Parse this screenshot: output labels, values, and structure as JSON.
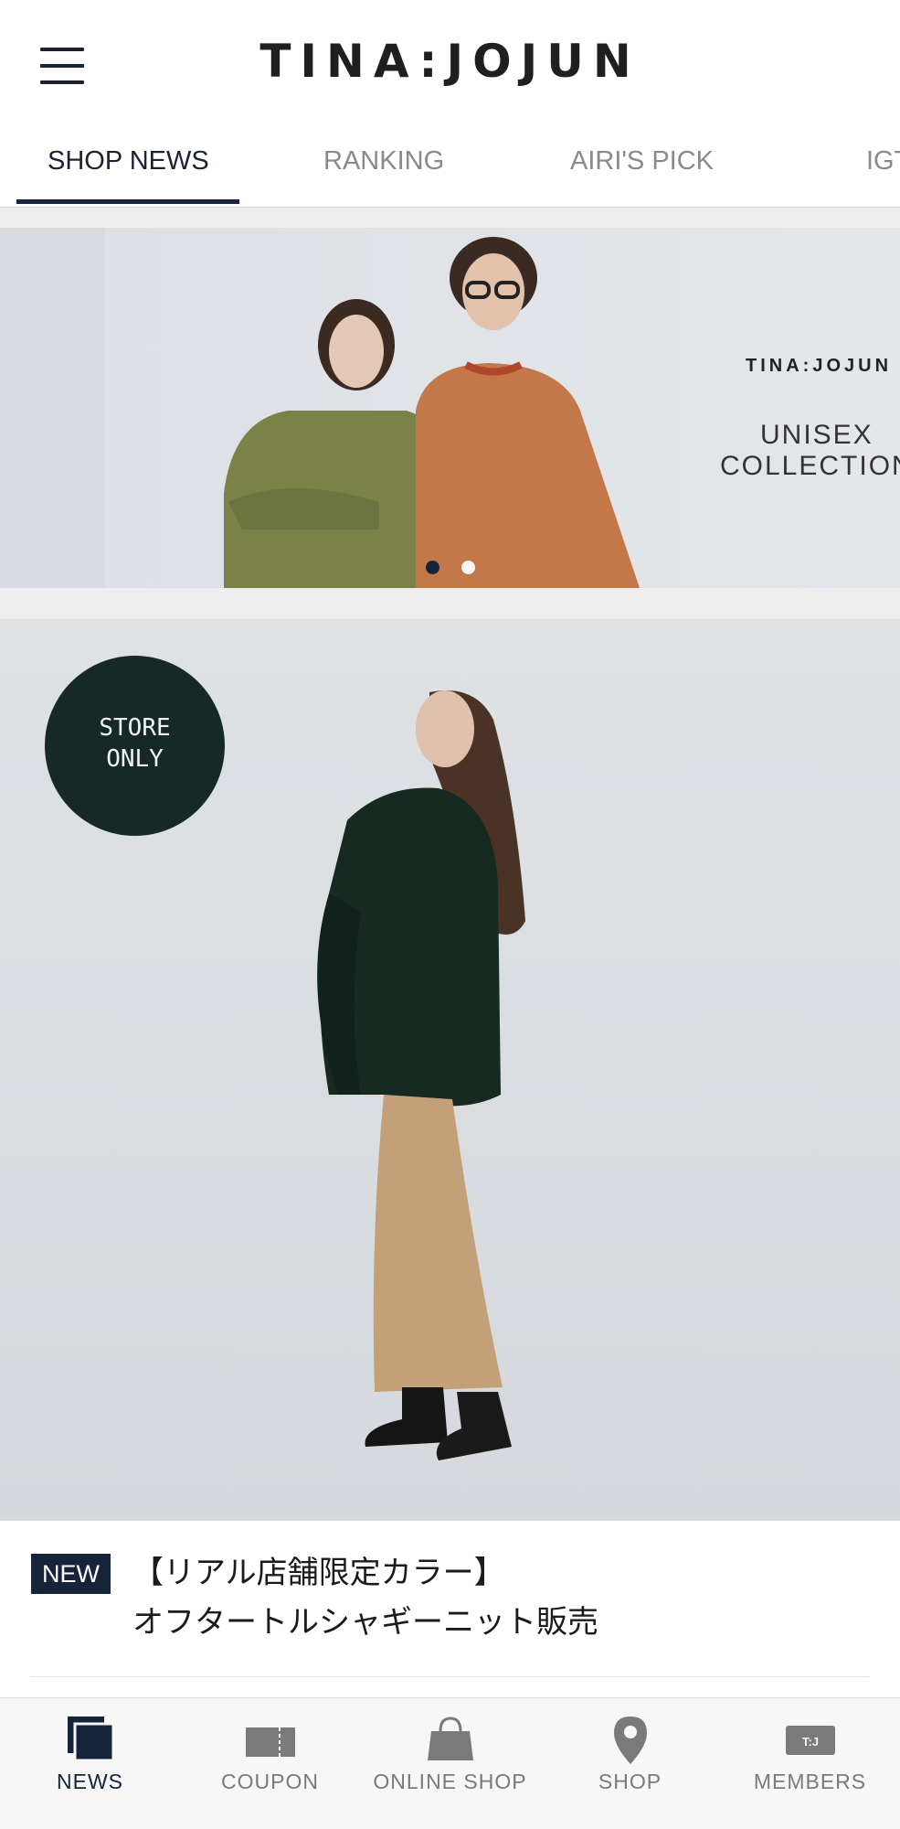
{
  "header": {
    "logo_text": "TINA:JOJUN",
    "menu_icon": "hamburger-menu-icon"
  },
  "tabs": [
    {
      "label": "SHOP NEWS",
      "active": true
    },
    {
      "label": "RANKING",
      "active": false
    },
    {
      "label": "AIRI'S PICK",
      "active": false
    },
    {
      "label": "IGT",
      "active": false
    }
  ],
  "banner": {
    "brand": "TINA:JOJUN",
    "line1": "UNISEX",
    "line2": "COLLECTION",
    "slide_count": 2,
    "active_slide": 1
  },
  "feature": {
    "badge_line1": "STORE",
    "badge_line2": "ONLY"
  },
  "news": {
    "badge": "NEW",
    "title_line1": "【リアル店舗限定カラー】",
    "title_line2": "オフタートルシャギーニット販売"
  },
  "bottom_nav": [
    {
      "label": "NEWS",
      "icon": "news-icon",
      "active": true
    },
    {
      "label": "COUPON",
      "icon": "coupon-icon",
      "active": false
    },
    {
      "label": "ONLINE SHOP",
      "icon": "shopping-bag-icon",
      "active": false
    },
    {
      "label": "SHOP",
      "icon": "location-pin-icon",
      "active": false
    },
    {
      "label": "MEMBERS",
      "icon": "member-card-icon",
      "icon_text": "T:J",
      "active": false
    }
  ],
  "colors": {
    "navy": "#16243a",
    "badge_green": "#162926",
    "tab_inactive": "#8a8a8a",
    "nav_inactive": "#7a7a7a"
  }
}
